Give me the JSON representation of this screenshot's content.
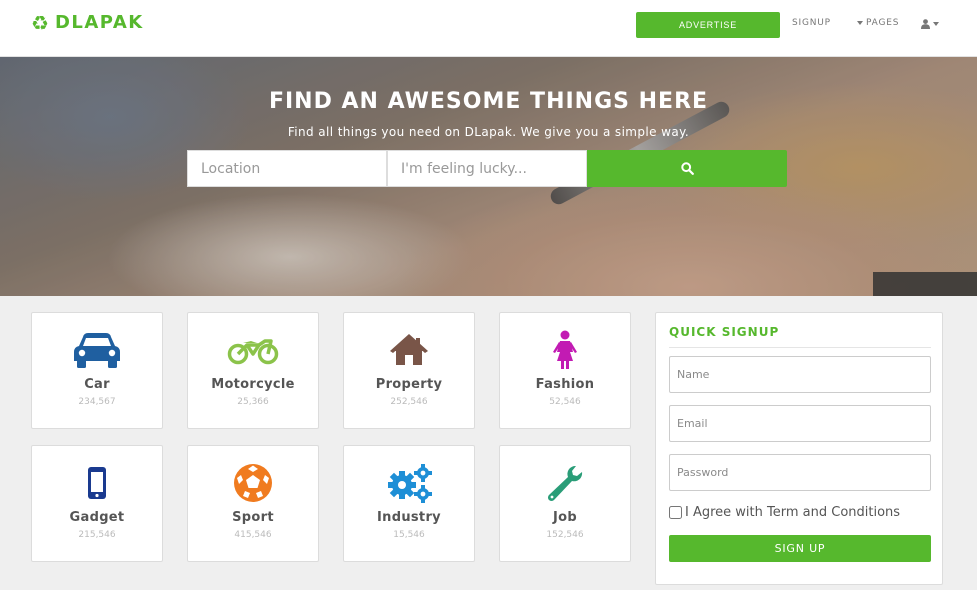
{
  "brand": {
    "name": "DLAPAK",
    "logo_icon": "recycle-icon",
    "color": "#56b82d"
  },
  "nav": {
    "advertise_label": "ADVERTISE",
    "signup_label": "SIGNUP",
    "pages_label": "PAGES",
    "user_icon": "user-icon"
  },
  "hero": {
    "title": "FIND AN AWESOME THINGS HERE",
    "subtitle": "Find all things you need on DLapak. We give you a simple way.",
    "location_placeholder": "Location",
    "keyword_placeholder": "I'm feeling lucky...",
    "search_icon": "search-icon"
  },
  "categories": [
    {
      "label": "Car",
      "count": "234,567",
      "icon": "car-icon",
      "color": "#1f5fa0"
    },
    {
      "label": "Motorcycle",
      "count": "25,366",
      "icon": "motorcycle-icon",
      "color": "#8bc34a"
    },
    {
      "label": "Property",
      "count": "252,546",
      "icon": "house-icon",
      "color": "#795548"
    },
    {
      "label": "Fashion",
      "count": "52,546",
      "icon": "female-icon",
      "color": "#c21bb3"
    },
    {
      "label": "Gadget",
      "count": "215,546",
      "icon": "mobile-icon",
      "color": "#1a3a8f"
    },
    {
      "label": "Sport",
      "count": "415,546",
      "icon": "soccer-ball-icon",
      "color": "#f07b1f"
    },
    {
      "label": "Industry",
      "count": "15,546",
      "icon": "gears-icon",
      "color": "#1e8fd6"
    },
    {
      "label": "Job",
      "count": "152,546",
      "icon": "wrench-icon",
      "color": "#2a9d78"
    }
  ],
  "signup": {
    "title": "QUICK SIGNUP",
    "name_placeholder": "Name",
    "email_placeholder": "Email",
    "password_placeholder": "Password",
    "agree_label": "I Agree with Term and Conditions",
    "button_label": "SIGN UP"
  }
}
